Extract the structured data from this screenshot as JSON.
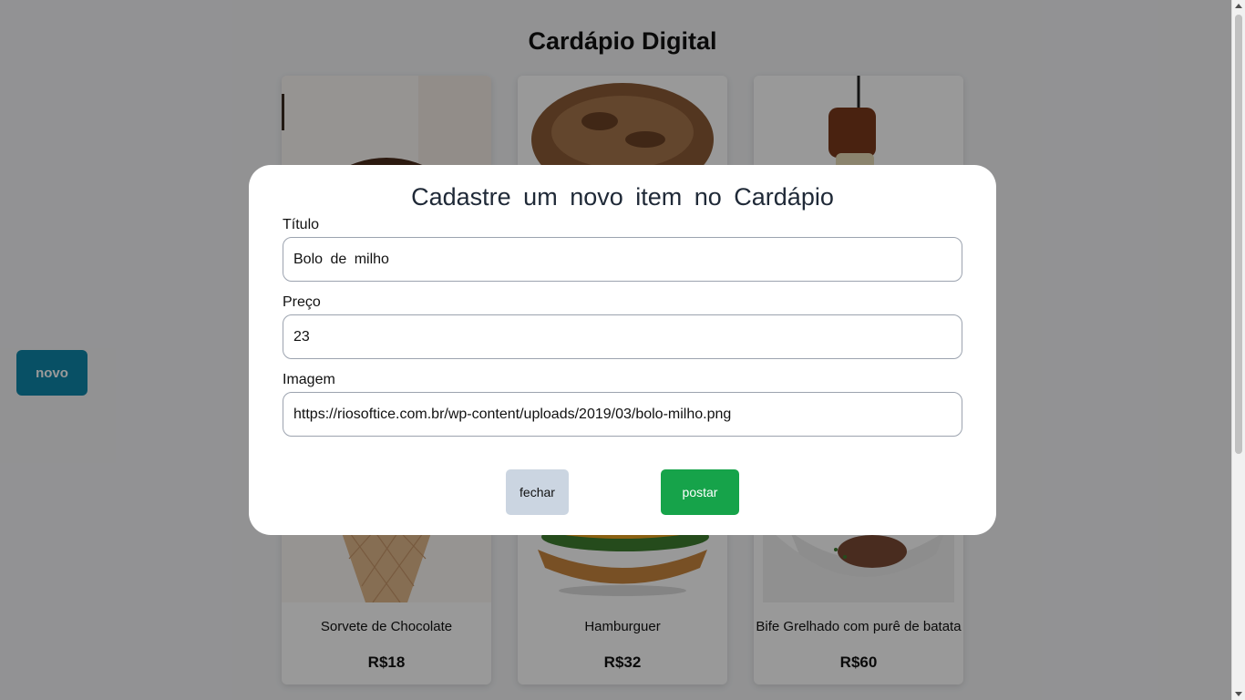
{
  "page": {
    "title": "Cardápio Digital",
    "new_button_label": "novo"
  },
  "menu_items": [
    {
      "name": "Sorvete de Chocolate",
      "price": "R$18",
      "image": "ice-cream-cone-image"
    },
    {
      "name": "Hamburguer",
      "price": "R$32",
      "image": "hamburger-image"
    },
    {
      "name": "Bife Grelhado com purê de batata",
      "price": "R$60",
      "image": "grilled-steak-image"
    }
  ],
  "modal": {
    "title": "Cadastre um novo item no Cardápio",
    "fields": {
      "titulo": {
        "label": "Título",
        "value": "Bolo de milho"
      },
      "preco": {
        "label": "Preço",
        "value": "23"
      },
      "imagem": {
        "label": "Imagem",
        "value": "https://riosoftice.com.br/wp-content/uploads/2019/03/bolo-milho.png"
      }
    },
    "close_label": "fechar",
    "submit_label": "postar"
  },
  "colors": {
    "new_button": "#0e86a8",
    "submit_button": "#16a34a",
    "close_button": "#cbd5e1"
  }
}
